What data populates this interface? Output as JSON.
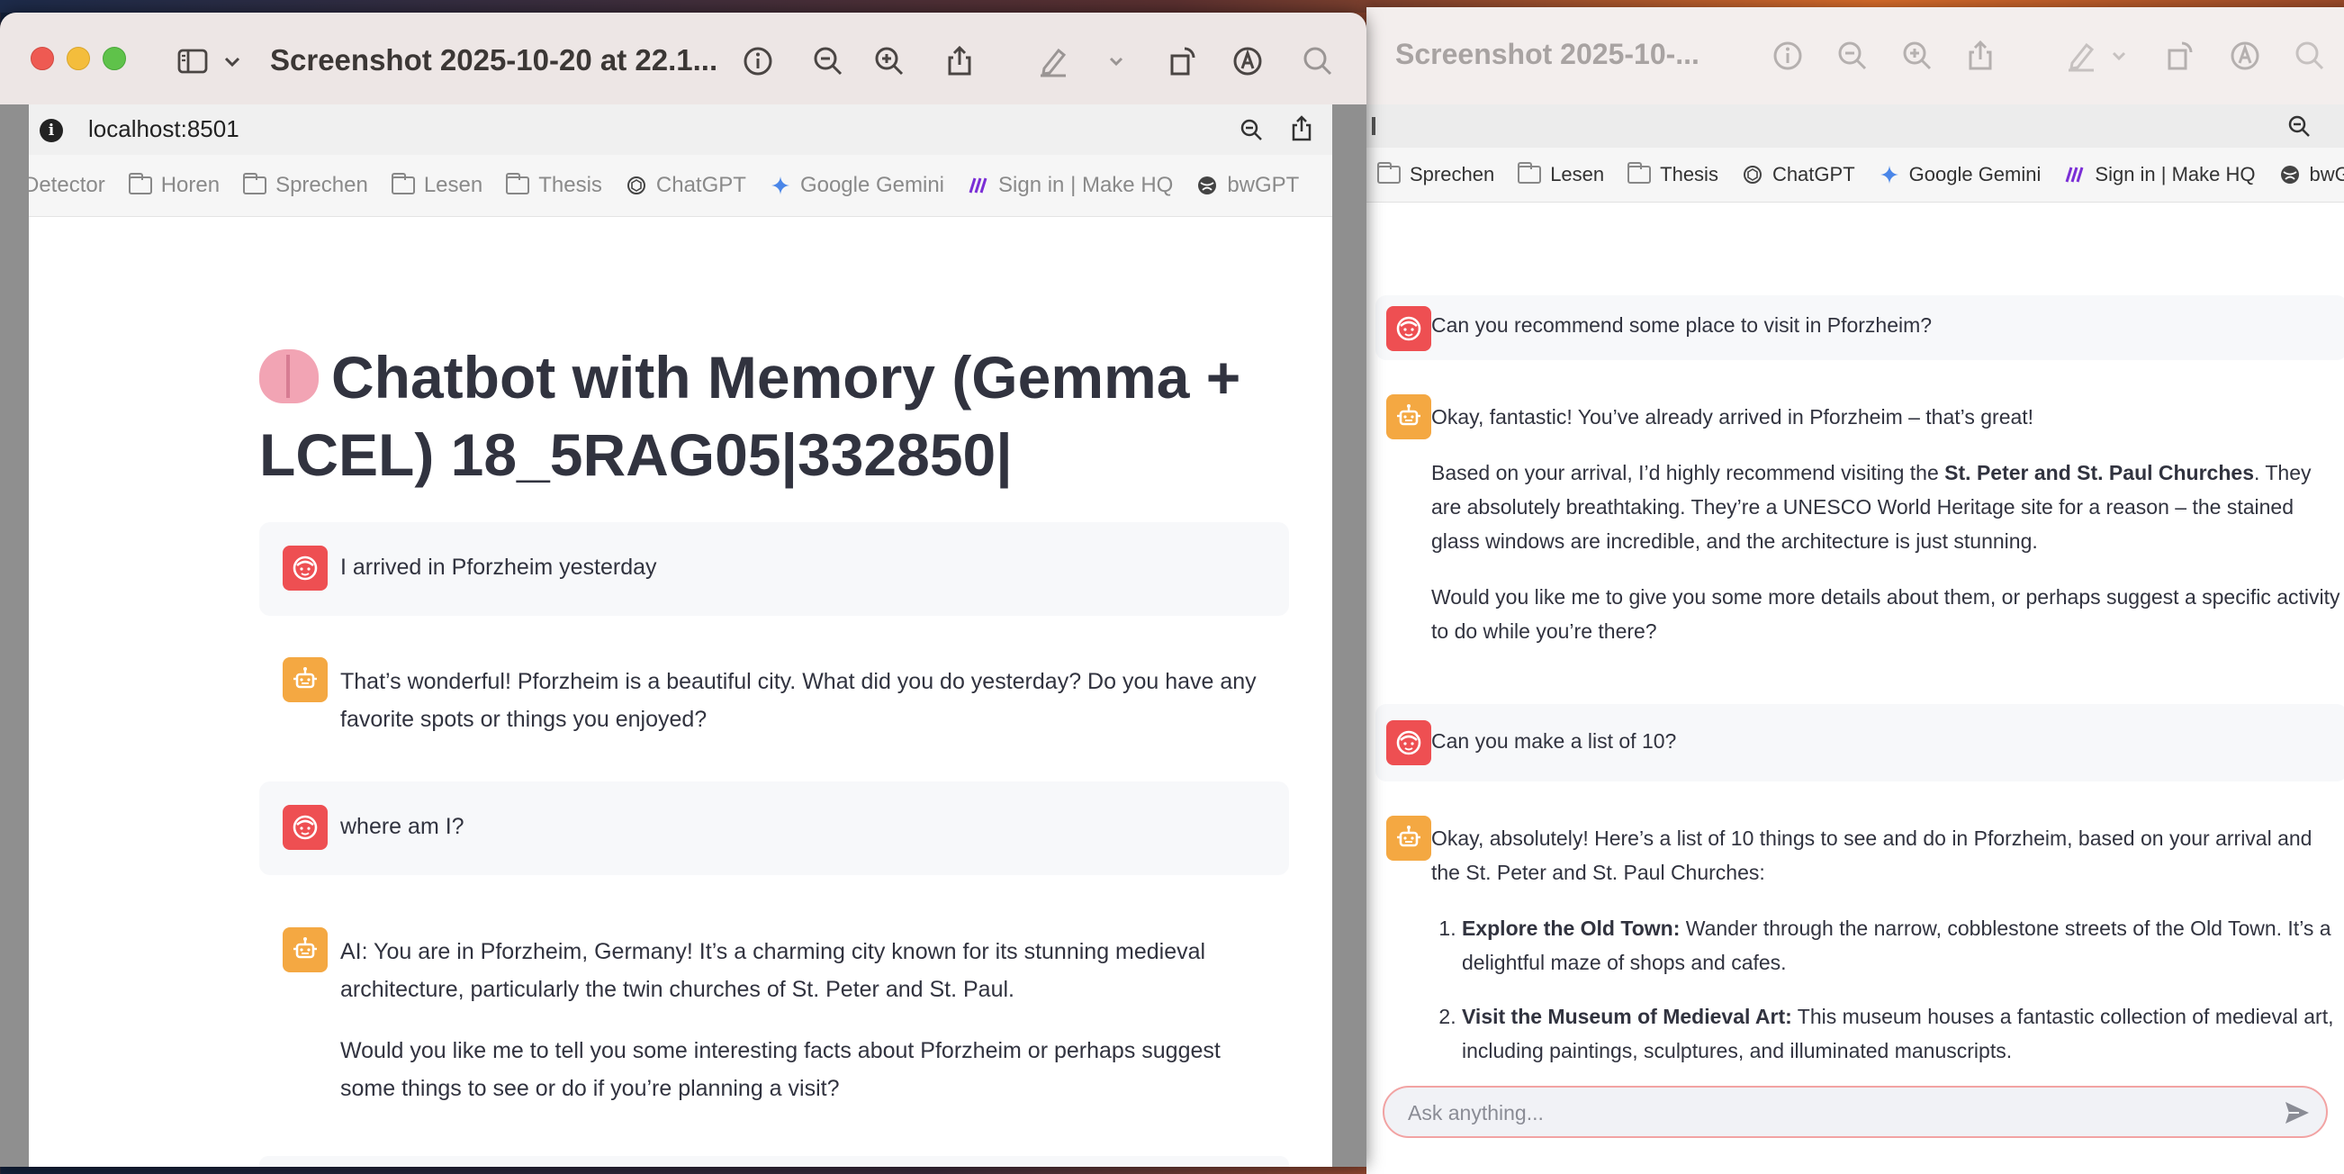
{
  "left_window": {
    "title": "Screenshot 2025-10-20 at 22.1...",
    "address": "localhost:8501",
    "bookmarks": [
      "Detector",
      "Horen",
      "Sprechen",
      "Lesen",
      "Thesis",
      "ChatGPT",
      "Google Gemini",
      "Sign in | Make HQ",
      "bwGPT"
    ],
    "heading": "Chatbot with Memory (Gemma + LCEL) 18_5RAG05|332850|",
    "messages": [
      {
        "role": "user",
        "text": "I arrived in Pforzheim yesterday"
      },
      {
        "role": "assistant",
        "text": "That’s wonderful! Pforzheim is a beautiful city. What did you do yesterday? Do you have any favorite spots or things you enjoyed?"
      },
      {
        "role": "user",
        "text": "where am I?"
      },
      {
        "role": "assistant",
        "p1": "AI: You are in Pforzheim, Germany! It’s a charming city known for its stunning medieval architecture, particularly the twin churches of St. Peter and St. Paul.",
        "p2": "Would you like me to tell you some interesting facts about Pforzheim or perhaps suggest some things to see or do if you’re planning a visit?"
      }
    ]
  },
  "right_window": {
    "title": "Screenshot 2025-10-...",
    "bookmarks": [
      "Sprechen",
      "Lesen",
      "Thesis",
      "ChatGPT",
      "Google Gemini",
      "Sign in | Make HQ",
      "bwGPT"
    ],
    "messages": {
      "q1": "Can you recommend some place to visit in Pforzheim?",
      "a1_p1": "Okay, fantastic! You’ve already arrived in Pforzheim – that’s great!",
      "a1_p2_pre": "Based on your arrival, I’d highly recommend visiting the ",
      "a1_p2_bold": "St. Peter and St. Paul Churches",
      "a1_p2_post": ". They are absolutely breathtaking. They’re a UNESCO World Heritage site for a reason – the stained glass windows are incredible, and the architecture is just stunning.",
      "a1_p3": "Would you like me to give you some more details about them, or perhaps suggest a specific activity to do while you’re there?",
      "q2": "Can you make a list of 10?",
      "a2_intro": "Okay, absolutely! Here’s a list of 10 things to see and do in Pforzheim, based on your arrival and the St. Peter and St. Paul Churches:",
      "list": [
        {
          "title": "Explore the Old Town:",
          "text": " Wander through the narrow, cobblestone streets of the Old Town. It’s a delightful maze of shops and cafes."
        },
        {
          "title": "Visit the Museum of Medieval Art:",
          "text": " This museum houses a fantastic collection of medieval art, including paintings, sculptures, and illuminated manuscripts."
        }
      ]
    },
    "chat_input_placeholder": "Ask anything..."
  },
  "colors": {
    "user_avatar": "#ee4f52",
    "bot_avatar": "#f4a842",
    "text": "#31333f"
  }
}
